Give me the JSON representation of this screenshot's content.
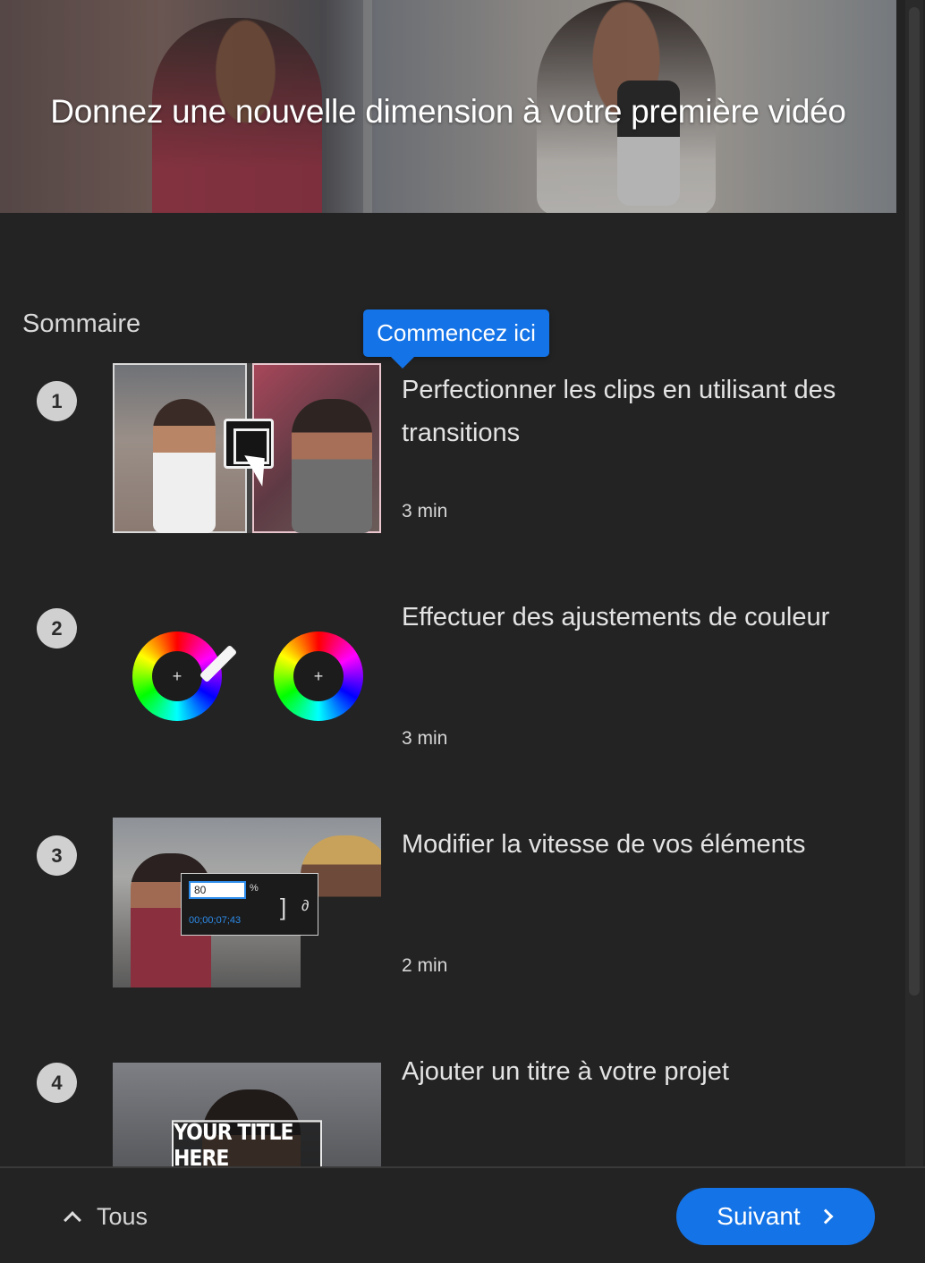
{
  "hero": {
    "title": "Donnez une nouvelle dimension à votre première vidéo"
  },
  "summary": {
    "heading": "Sommaire"
  },
  "tooltip": {
    "label": "Commencez ici"
  },
  "lessons": [
    {
      "number": "1",
      "title": "Perfectionner les clips en utilisant des transitions",
      "duration": "3 min",
      "thumbnail": "transitions-thumbnail"
    },
    {
      "number": "2",
      "title": "Effectuer des ajustements de couleur",
      "duration": "3 min",
      "thumbnail": "color-wheels-thumbnail"
    },
    {
      "number": "3",
      "title": "Modifier la vitesse de vos éléments",
      "duration": "2 min",
      "thumbnail": "speed-thumbnail",
      "speed_value": "80",
      "speed_unit": "%",
      "timecode": "00;00;07;43"
    },
    {
      "number": "4",
      "title": "Ajouter un titre à votre projet",
      "duration": "",
      "thumbnail": "title-thumbnail",
      "title_overlay": "YOUR TITLE HERE"
    }
  ],
  "footer": {
    "all_label": "Tous",
    "next_label": "Suivant"
  },
  "colors": {
    "background": "#232323",
    "accent": "#1473e6",
    "text": "#e3e3e3"
  }
}
